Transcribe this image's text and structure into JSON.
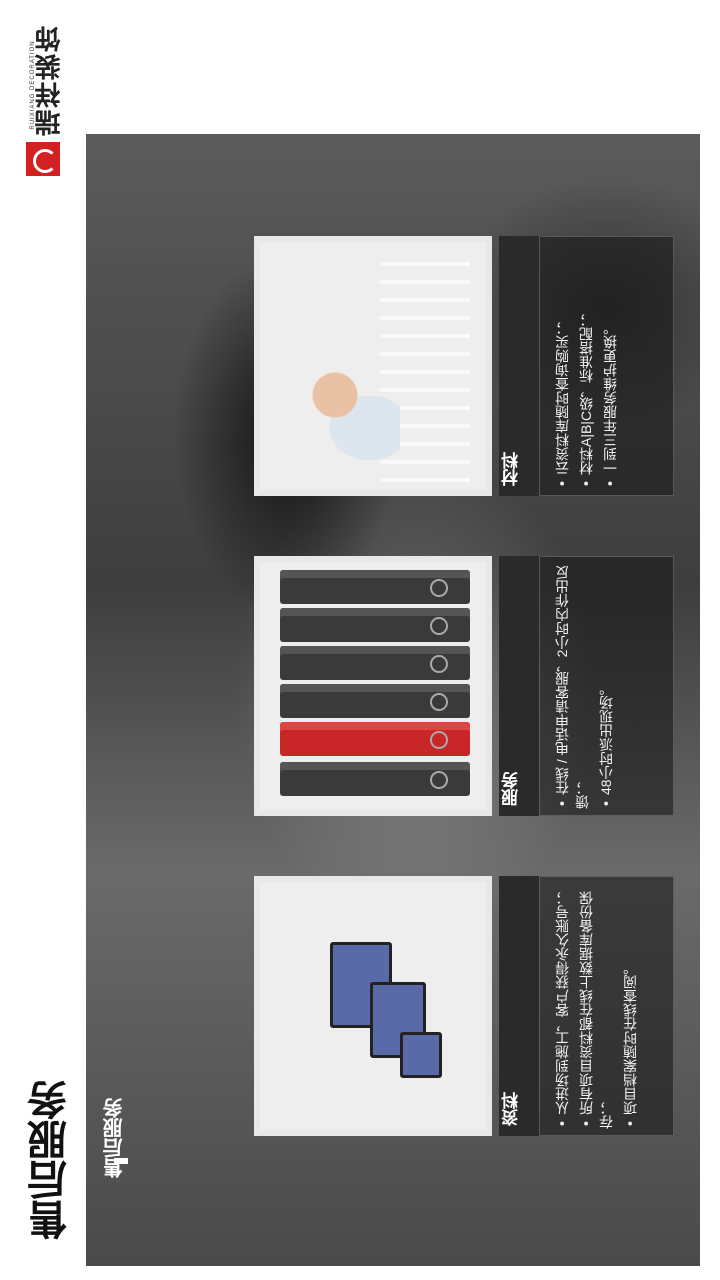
{
  "brand": {
    "name_cn": "瑞祥装饰",
    "name_en": "RUIXIANG DECORATION",
    "accent_color": "#d32020"
  },
  "page_title": "售后服务",
  "section_label": "售后服务",
  "cards": [
    {
      "key": "docs",
      "title": "资料",
      "image_icon": "cloud-globe-devices-icon",
      "bullets": [
        "从进场到施工，客户获得永久账号；",
        "所有项目资料都在线上数据库备份保存；",
        "项目档案随时在线查阅。"
      ]
    },
    {
      "key": "service",
      "title": "服务",
      "image_icon": "binders-icon",
      "bullets": [
        "在线 / 电话申请客服，2小时内作出反馈；",
        "48小时派出现场。"
      ]
    },
    {
      "key": "material",
      "title": "材料",
      "image_icon": "tech-support-woman-icon",
      "bullets": [
        "云资料库随时查询购买；",
        "材料A|B|C级，标准搭配；",
        "一到三年服务维护更换。"
      ]
    }
  ]
}
